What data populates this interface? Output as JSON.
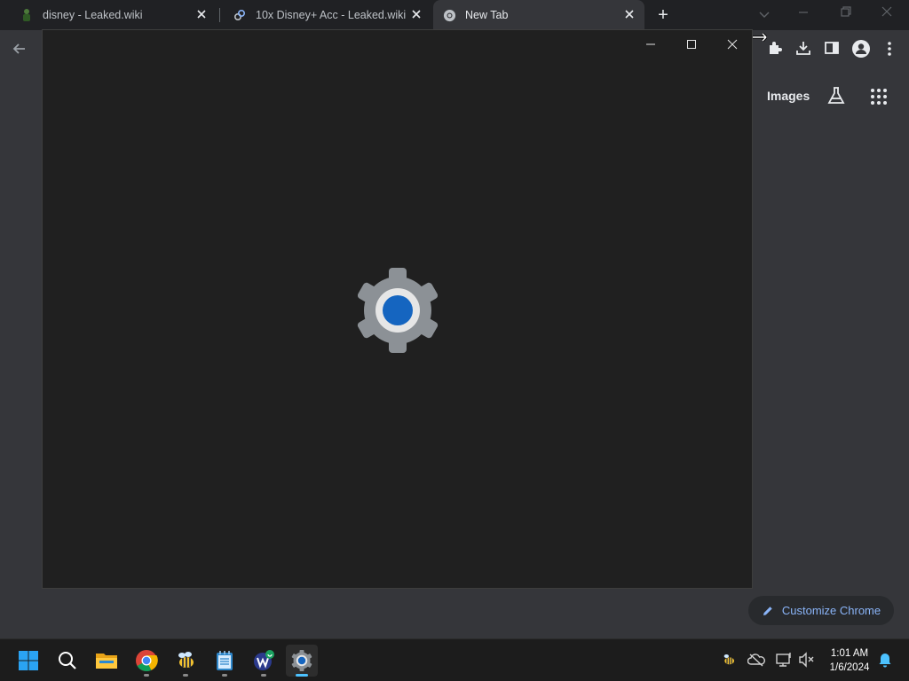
{
  "tabs": [
    {
      "title": "disney - Leaked.wiki",
      "favicon": "leaked-wiki-favicon"
    },
    {
      "title": "10x Disney+ Acc - Leaked.wiki",
      "favicon": "link-favicon"
    },
    {
      "title": "New Tab",
      "favicon": "chrome-favicon"
    }
  ],
  "new_tab_label": "+",
  "google_bar": {
    "images_label": "Images"
  },
  "customize_chrome_label": "Customize Chrome",
  "clock": {
    "time": "1:01 AM",
    "date": "1/6/2024"
  },
  "taskbar_apps": [
    "start-icon",
    "search-icon",
    "file-explorer-icon",
    "chrome-icon",
    "bee-app-icon",
    "notepad-icon",
    "wps-app-icon",
    "settings-icon"
  ],
  "colors": {
    "accent": "#4cc2ff",
    "gear_center": "#1565c0",
    "link": "#8ab4f8"
  }
}
